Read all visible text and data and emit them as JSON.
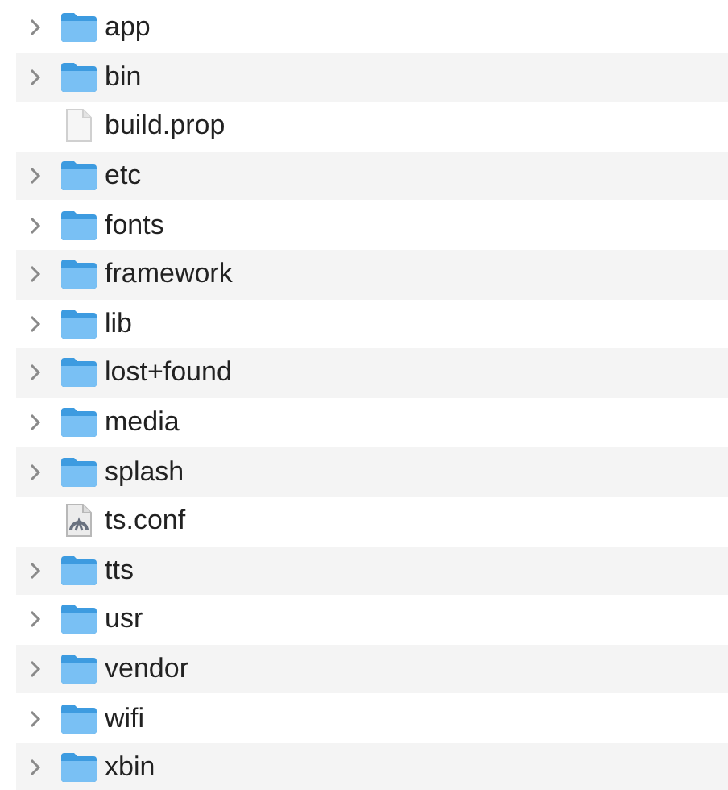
{
  "items": [
    {
      "name": "app",
      "kind": "folder",
      "expanded": false
    },
    {
      "name": "bin",
      "kind": "folder",
      "expanded": false
    },
    {
      "name": "build.prop",
      "kind": "file"
    },
    {
      "name": "etc",
      "kind": "folder",
      "expanded": false
    },
    {
      "name": "fonts",
      "kind": "folder",
      "expanded": false
    },
    {
      "name": "framework",
      "kind": "folder",
      "expanded": false
    },
    {
      "name": "lib",
      "kind": "folder",
      "expanded": false
    },
    {
      "name": "lost+found",
      "kind": "folder",
      "expanded": false
    },
    {
      "name": "media",
      "kind": "folder",
      "expanded": false
    },
    {
      "name": "splash",
      "kind": "folder",
      "expanded": false
    },
    {
      "name": "ts.conf",
      "kind": "document"
    },
    {
      "name": "tts",
      "kind": "folder",
      "expanded": false
    },
    {
      "name": "usr",
      "kind": "folder",
      "expanded": false
    },
    {
      "name": "vendor",
      "kind": "folder",
      "expanded": false
    },
    {
      "name": "wifi",
      "kind": "folder",
      "expanded": false
    },
    {
      "name": "xbin",
      "kind": "folder",
      "expanded": false
    }
  ]
}
